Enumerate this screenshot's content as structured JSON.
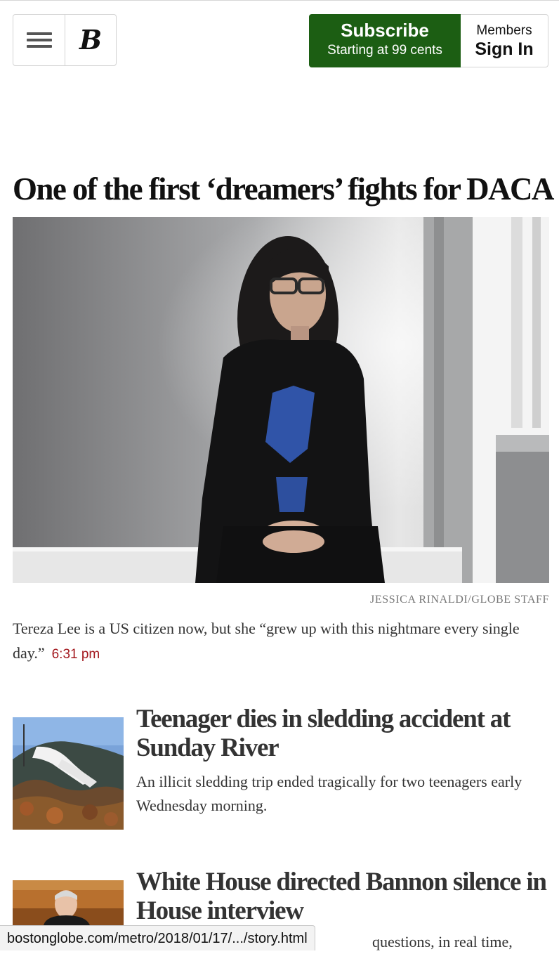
{
  "header": {
    "menu_icon": "hamburger-menu-icon",
    "logo_text": "B",
    "subscribe": {
      "title": "Subscribe",
      "subtitle": "Starting at 99 cents",
      "color": "#1c5e13"
    },
    "signin": {
      "label_top": "Members",
      "label_main": "Sign In"
    }
  },
  "lead": {
    "headline": "One of the first ‘dreamers’ fights for DACA",
    "photo_credit": "JESSICA RINALDI/GLOBE STAFF",
    "dek": "Tereza Lee is a US citizen now, but she “grew up with this nightmare every single day.”",
    "timestamp": "6:31 pm",
    "timestamp_color": "#a3181e"
  },
  "stories": [
    {
      "headline": "Teenager dies in sledding accident at Sunday River",
      "dek": "An illicit sledding trip ended tragically for two teenagers early Wednesday morning."
    },
    {
      "headline": "White House directed Bannon silence in House interview",
      "dek": "questions, in real time,"
    }
  ],
  "statusbar": {
    "url": "bostonglobe.com/metro/2018/01/17/.../story.html"
  }
}
